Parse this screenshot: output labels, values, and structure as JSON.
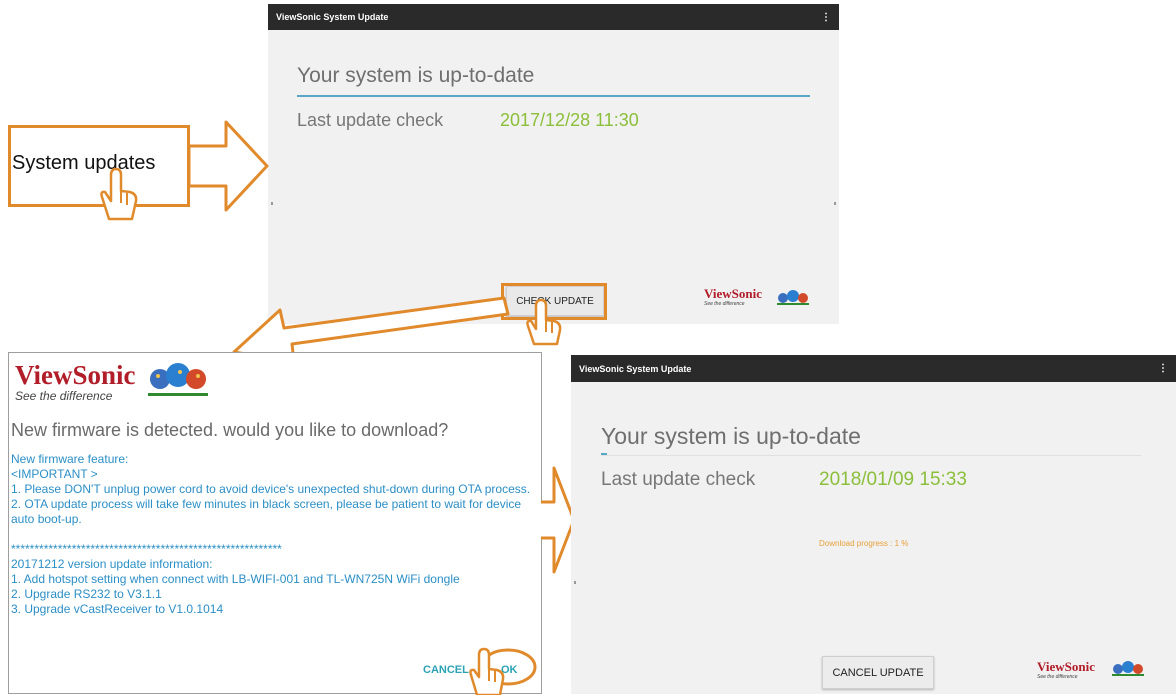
{
  "top_screen": {
    "window_title": "ViewSonic System Update",
    "menu_icon": "more-vert-icon",
    "status": "Your system is up-to-date",
    "last_check_label": "Last update check",
    "last_check_value": "2017/12/28 11:30",
    "button_label": "CHECK UPDATE",
    "logo_text": "ViewSonic",
    "logo_tagline": "See the difference"
  },
  "callout": {
    "label": "System updates"
  },
  "dialog": {
    "logo_text": "ViewSonic",
    "logo_tagline": "See the difference",
    "question": "New firmware is detected. would you like to download?",
    "body": "New firmware feature:\n<IMPORTANT >\n1. Please DON'T unplug power cord to avoid device's unexpected shut-down during OTA process.\n2. OTA update process will take few minutes in black screen, please be patient to wait for device auto boot-up.\n\n**********************************************************\n20171212 version update information:\n1. Add hotspot setting when connect with LB-WIFI-001 and TL-WN725N WiFi dongle\n2. Upgrade RS232 to V3.1.1\n3. Upgrade vCastReceiver to V1.0.1014",
    "cancel_label": "CANCEL",
    "ok_label": "OK"
  },
  "bottom_screen": {
    "window_title": "ViewSonic System Update",
    "menu_icon": "more-vert-icon",
    "status": "Your system is up-to-date",
    "last_check_label": "Last update check",
    "last_check_value": "2018/01/09 15:33",
    "download_progress_text": "Download progress : 1 %",
    "download_progress_fraction": 0.01,
    "button_label": "CANCEL UPDATE",
    "logo_text": "ViewSonic",
    "logo_tagline": "See the difference"
  },
  "colors": {
    "accent_orange": "#e08a2c",
    "date_green": "#8bbf3a",
    "dialog_text_blue": "#2b8fc7",
    "titlebar": "#2a2a2a",
    "logo_red": "#b11d28"
  }
}
